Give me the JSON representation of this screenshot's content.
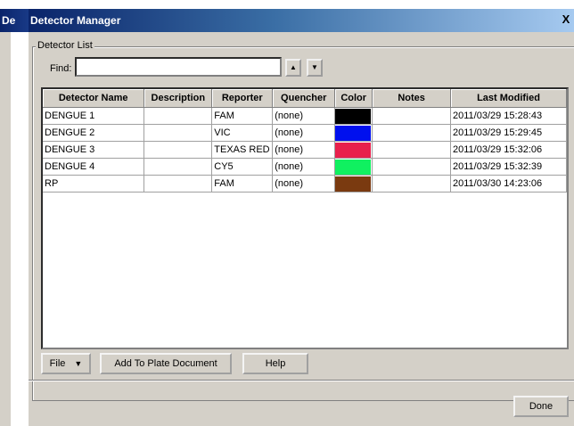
{
  "background_window": {
    "title_fragment": "De"
  },
  "dialog": {
    "title": "Detector Manager",
    "close_glyph": "X"
  },
  "detector_list": {
    "group_label": "Detector List",
    "find_label": "Find:",
    "find_value": "",
    "up_arrow": "▲",
    "down_arrow": "▼"
  },
  "table": {
    "columns": [
      "Detector Name",
      "Description",
      "Reporter",
      "Quencher",
      "Color",
      "Notes",
      "Last Modified"
    ],
    "rows": [
      {
        "name": "DENGUE 1",
        "description": "",
        "reporter": "FAM",
        "quencher": "(none)",
        "color": "#000000",
        "notes": "",
        "modified": "2011/03/29 15:28:43"
      },
      {
        "name": "DENGUE 2",
        "description": "",
        "reporter": "VIC",
        "quencher": "(none)",
        "color": "#0010ee",
        "notes": "",
        "modified": "2011/03/29 15:29:45"
      },
      {
        "name": "DENGUE 3",
        "description": "",
        "reporter": "TEXAS RED",
        "quencher": "(none)",
        "color": "#e8204c",
        "notes": "",
        "modified": "2011/03/29 15:32:06"
      },
      {
        "name": "DENGUE 4",
        "description": "",
        "reporter": "CY5",
        "quencher": "(none)",
        "color": "#10f060",
        "notes": "",
        "modified": "2011/03/29 15:32:39"
      },
      {
        "name": "RP",
        "description": "",
        "reporter": "FAM",
        "quencher": "(none)",
        "color": "#7a3a10",
        "notes": "",
        "modified": "2011/03/30 14:23:06"
      }
    ]
  },
  "buttons": {
    "file": "File",
    "file_caret": "▼",
    "add_to_plate": "Add To Plate Document",
    "help": "Help",
    "done": "Done"
  }
}
